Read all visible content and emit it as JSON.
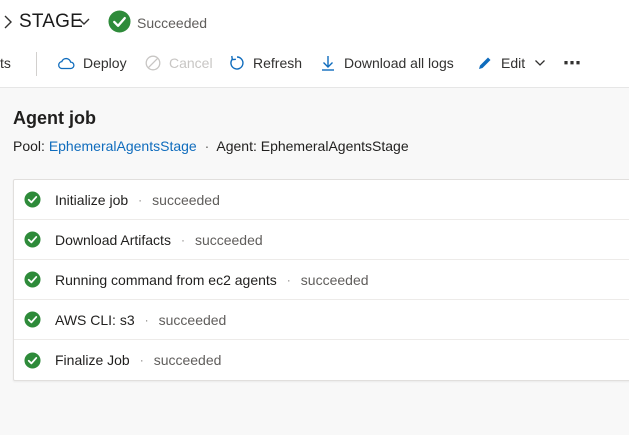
{
  "header": {
    "stage_title": "STAGE",
    "status": "Succeeded",
    "colors": {
      "success": "#2e8b3a",
      "link": "#0f6cbd"
    }
  },
  "toolbar": {
    "partial_label": "ts",
    "deploy": "Deploy",
    "cancel": "Cancel",
    "refresh": "Refresh",
    "download": "Download all logs",
    "edit": "Edit",
    "more": "⋯"
  },
  "job": {
    "title": "Agent job",
    "pool_label": "Pool:",
    "pool_name": "EphemeralAgentsStage",
    "separator": "·",
    "agent_text": "Agent: EphemeralAgentsStage"
  },
  "steps": [
    {
      "name": "Initialize job",
      "status": "succeeded"
    },
    {
      "name": "Download Artifacts",
      "status": "succeeded"
    },
    {
      "name": "Running command from ec2 agents",
      "status": "succeeded"
    },
    {
      "name": "AWS CLI: s3",
      "status": "succeeded"
    },
    {
      "name": "Finalize Job",
      "status": "succeeded"
    }
  ],
  "step_separator": "·"
}
